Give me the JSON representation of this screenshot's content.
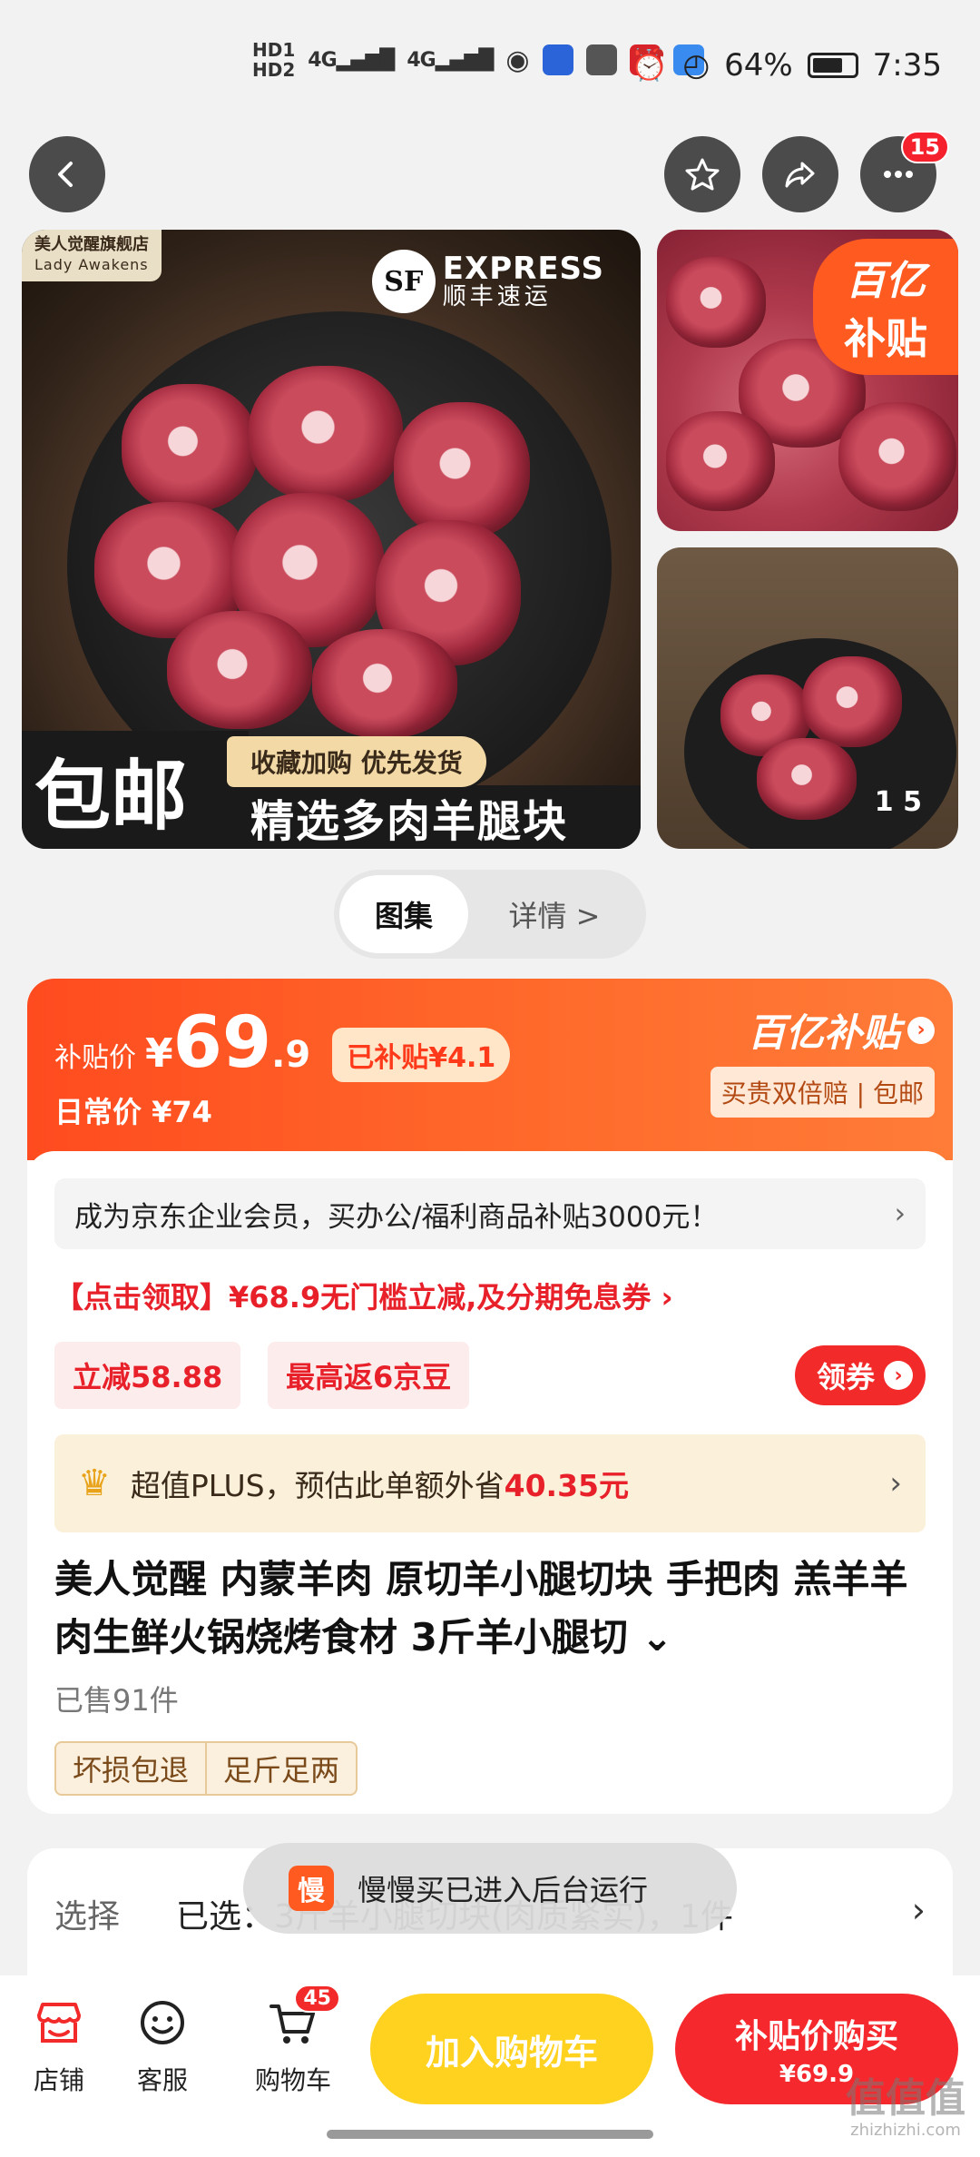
{
  "status_bar": {
    "hd1": "HD1",
    "hd2": "HD2",
    "net1": "4G",
    "net2": "4G",
    "battery": "64%",
    "time": "7:35"
  },
  "header": {
    "more_badge": "15"
  },
  "gallery": {
    "store_cn": "美人觉醒旗舰店",
    "store_en": "Lady Awakens",
    "sf_logo": "SF",
    "sf_en": "EXPRESS",
    "sf_cn": "顺丰速运",
    "baoyou": "包邮",
    "collect": "收藏加购 优先发货",
    "strip_title": "精选多肉羊腿块",
    "yi_tag_l1": "百亿",
    "yi_tag_l2": "补贴",
    "counter": "1 5"
  },
  "tabs": {
    "gallery": "图集",
    "detail": "详情 >"
  },
  "price": {
    "label": "补贴价",
    "yen": "¥",
    "integer": "69",
    "decimal": ".9",
    "subsidy": "已补贴¥4.1",
    "daily": "日常价 ¥74",
    "yi_logo": "百亿补贴",
    "yi_sub": "买贵双倍赔 | 包邮"
  },
  "promos": {
    "enterprise": "成为京东企业会员，买办公/福利商品补贴3000元！",
    "coupon": "【点击领取】¥68.9无门槛立减,及分期免息券 ›",
    "chip1": "立减58.88",
    "chip2": "最高返6京豆",
    "lingquan": "领券",
    "plus_prefix": "超值PLUS，预估此单额外省",
    "plus_amount": "40.35元"
  },
  "product": {
    "title": "美人觉醒 内蒙羊肉 原切羊小腿切块 手把肉 羔羊羊肉生鲜火锅烧烤食材 3斤羊小腿切 ⌄",
    "sold": "已售91件",
    "tag1": "坏损包退",
    "tag2": "足斤足两"
  },
  "select": {
    "label": "选择",
    "value": "已选：3斤羊小腿切块(肉质紧实)，1件"
  },
  "toast": {
    "icon": "慢",
    "text": "慢慢买已进入后台运行"
  },
  "bottom": {
    "store": "店铺",
    "service": "客服",
    "cart": "购物车",
    "cart_badge": "45",
    "add_cart": "加入购物车",
    "buy": "补贴价购买",
    "buy_price": "¥69.9"
  },
  "watermark": {
    "cn": "值值值",
    "en": "zhizhizhi.com"
  },
  "colors": {
    "accent_red": "#f5282d",
    "accent_yellow": "#ffd21f",
    "banner_orange": "#ff4b1f"
  }
}
